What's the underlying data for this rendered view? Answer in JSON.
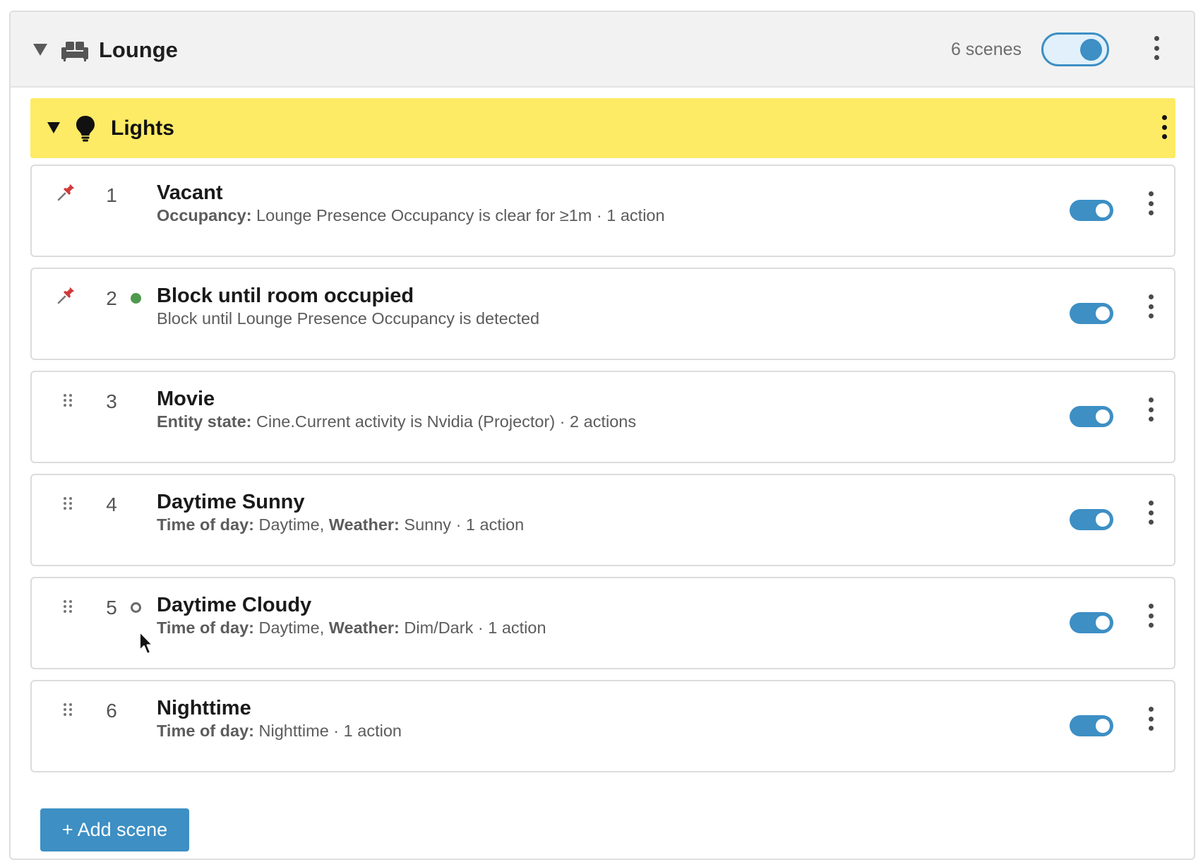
{
  "room": {
    "name": "Lounge",
    "scene_count": "6 scenes",
    "enabled": true,
    "icon": "sofa-icon"
  },
  "group": {
    "name": "Lights",
    "icon": "lightbulb-icon",
    "color": "#fdeb66"
  },
  "scenes": [
    {
      "number": "1",
      "handle": "pin-icon",
      "status": "none",
      "title": "Vacant",
      "label": "Occupancy:",
      "detail": " Lounge Presence Occupancy is clear for ≥1m · 1 action",
      "enabled": true
    },
    {
      "number": "2",
      "handle": "pin-icon",
      "status": "active",
      "title": "Block until room occupied",
      "label": "",
      "detail": "Block until Lounge Presence Occupancy is detected",
      "enabled": true
    },
    {
      "number": "3",
      "handle": "drag-handle-icon",
      "status": "none",
      "title": "Movie",
      "label": "Entity state:",
      "detail": " Cine.Current activity is Nvidia (Projector) · 2 actions",
      "enabled": true
    },
    {
      "number": "4",
      "handle": "drag-handle-icon",
      "status": "none",
      "title": "Daytime Sunny",
      "label": "Time of day:",
      "detail": " Daytime, ",
      "label2": "Weather:",
      "detail2": " Sunny · 1 action",
      "enabled": true
    },
    {
      "number": "5",
      "handle": "drag-handle-icon",
      "status": "pending",
      "title": "Daytime Cloudy",
      "label": "Time of day:",
      "detail": " Daytime, ",
      "label2": "Weather:",
      "detail2": " Dim/Dark · 1 action",
      "enabled": true
    },
    {
      "number": "6",
      "handle": "drag-handle-icon",
      "status": "none",
      "title": "Nighttime",
      "label": "Time of day:",
      "detail": " Nighttime · 1 action",
      "enabled": true
    }
  ],
  "add_button": {
    "label": "+ Add scene"
  },
  "colors": {
    "accent": "#3d8fc4",
    "active_status": "#4f9a4d",
    "pin": "#d13a3a"
  }
}
